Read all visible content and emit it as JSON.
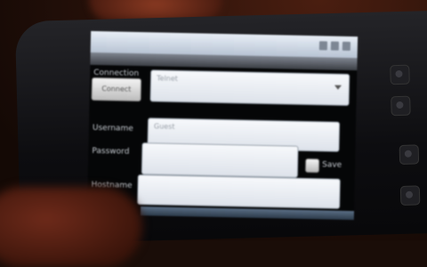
{
  "statusbar": {
    "icons": [
      "signal-icon",
      "wifi-icon",
      "battery-icon"
    ]
  },
  "titlebar": {
    "title": ""
  },
  "connection": {
    "label": "Connection",
    "button_label": "Connect",
    "select_value": "Telnet"
  },
  "username": {
    "label": "Username",
    "value": "",
    "placeholder": "Guest"
  },
  "password": {
    "label": "Password",
    "value": "",
    "placeholder": "",
    "checkbox_label": "Save"
  },
  "hostname": {
    "label": "Hostname",
    "value": "",
    "placeholder": ""
  },
  "colors": {
    "statusbar": "#c8d2de",
    "titlebar": "#55595f",
    "screen_bg": "#050607",
    "input_bg": "#eef1f5"
  }
}
